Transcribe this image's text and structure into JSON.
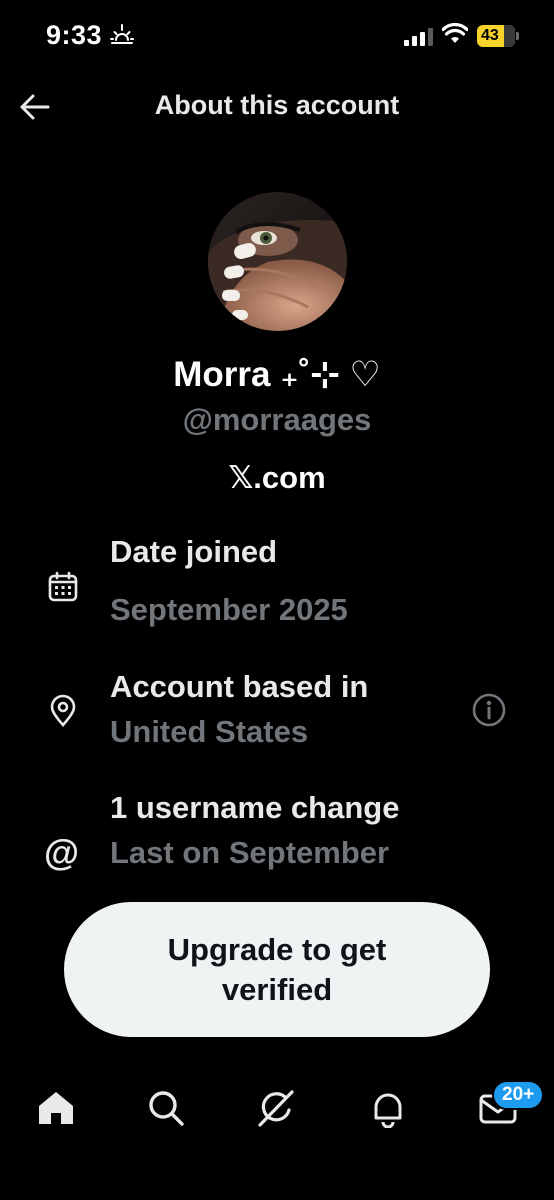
{
  "status_bar": {
    "time": "9:33",
    "battery": "43"
  },
  "header": {
    "title": "About this account"
  },
  "profile": {
    "display_name": "Morra ₊˚⊹ ♡",
    "handle": "@morraages",
    "platform": "𝕏.com"
  },
  "rows": {
    "date_joined": {
      "title": "Date joined",
      "value": "September 2025"
    },
    "based_in": {
      "title": "Account based in",
      "value": "United States"
    },
    "username": {
      "title": "1 username change",
      "value": "Last on September"
    }
  },
  "cta": {
    "label": "Upgrade to get verified"
  },
  "tab_bar": {
    "items": [
      "home-icon",
      "search-icon",
      "grok-icon",
      "notifications-icon",
      "messages-icon"
    ],
    "messages_badge": "20+"
  },
  "colors": {
    "accent": "#1d9bf0",
    "muted": "#71767b",
    "battery": "#f6d22b"
  }
}
